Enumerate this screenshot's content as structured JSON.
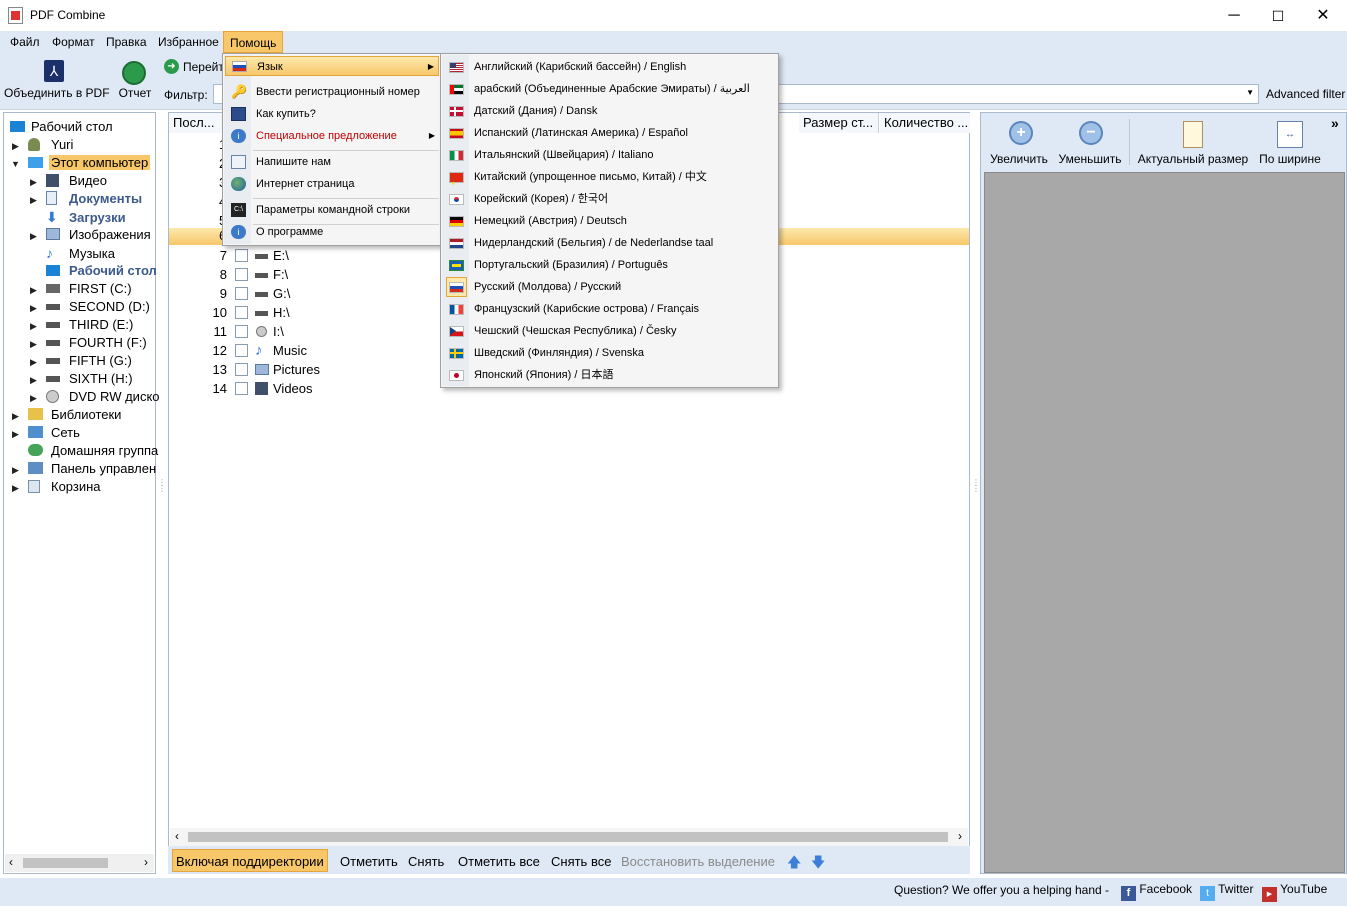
{
  "window": {
    "title": "PDF Combine"
  },
  "menubar": [
    "Файл",
    "Формат",
    "Правка",
    "Избранное",
    "Помощь"
  ],
  "toolbar": {
    "combine": "Объединить в PDF",
    "report": "Отчет",
    "goto": "Перейти",
    "filter_label": "Фильтр:",
    "advanced_filter": "Advanced filter"
  },
  "tree": [
    "Рабочий стол",
    "Yuri",
    "Этот компьютер",
    "Видео",
    "Документы",
    "Загрузки",
    "Изображения",
    "Музыка",
    "Рабочий стол",
    "FIRST (C:)",
    "SECOND (D:)",
    "THIRD (E:)",
    "FOURTH (F:)",
    "FIFTH (G:)",
    "SIXTH (H:)",
    "DVD RW диско",
    "Библиотеки",
    "Сеть",
    "Домашняя группа",
    "Панель управлен",
    "Корзина"
  ],
  "columns": {
    "seq": "Посл...",
    "size": "Размер ст...",
    "count": "Количество ..."
  },
  "rows": [
    {
      "n": "7",
      "name": "E:\\"
    },
    {
      "n": "8",
      "name": "F:\\"
    },
    {
      "n": "9",
      "name": "G:\\"
    },
    {
      "n": "10",
      "name": "H:\\"
    },
    {
      "n": "11",
      "name": "I:\\"
    },
    {
      "n": "12",
      "name": "Music"
    },
    {
      "n": "13",
      "name": "Pictures"
    },
    {
      "n": "14",
      "name": "Videos"
    }
  ],
  "partial_rows": [
    "1",
    "2",
    "3",
    "4",
    "5",
    "6"
  ],
  "bottom": {
    "include_subdirs": "Включая поддиректории",
    "mark": "Отметить",
    "unmark": "Снять",
    "mark_all": "Отметить все",
    "unmark_all": "Снять все",
    "restore": "Восстановить выделение"
  },
  "preview": {
    "zoom_in": "Увеличить",
    "zoom_out": "Уменьшить",
    "actual": "Актуальный размер",
    "fit_width": "По ширине",
    "more": "»"
  },
  "status": {
    "question": "Question? We offer you a helping hand -",
    "facebook": "Facebook",
    "twitter": "Twitter",
    "youtube": "YouTube"
  },
  "help_menu": {
    "language": "Язык",
    "register": "Ввести регистрационный номер",
    "how_to_buy": "Как купить?",
    "special_offer": "Специальное предложение",
    "write_us": "Напишите нам",
    "website": "Интернет страница",
    "cmdline": "Параметры командной строки",
    "about": "О программе"
  },
  "languages": [
    "Английский (Карибский бассейн) / English",
    "арабский (Объединенные Арабские Эмираты) / العربية",
    "Датский (Дания) / Dansk",
    "Испанский (Латинская Америка) / Español",
    "Итальянский (Швейцария) / Italiano",
    "Китайский (упрощенное письмо, Китай) / 中文",
    "Корейский (Корея) / 한국어",
    "Немецкий (Австрия) / Deutsch",
    "Нидерландский (Бельгия) / de Nederlandse taal",
    "Португальский (Бразилия) / Português",
    "Русский (Молдова) / Русский",
    "Французский (Карибские острова) / Français",
    "Чешский (Чешская Республика) / Česky",
    "Шведский (Финляндия) / Svenska",
    "Японский (Япония) / 日本語"
  ],
  "selected_language": "Русский (Молдова) / Русский",
  "colors": {
    "accent": "#f7c76a",
    "special": "#c00000",
    "panel": "#dfe9f5",
    "preview_bg": "#a8a8a8"
  }
}
